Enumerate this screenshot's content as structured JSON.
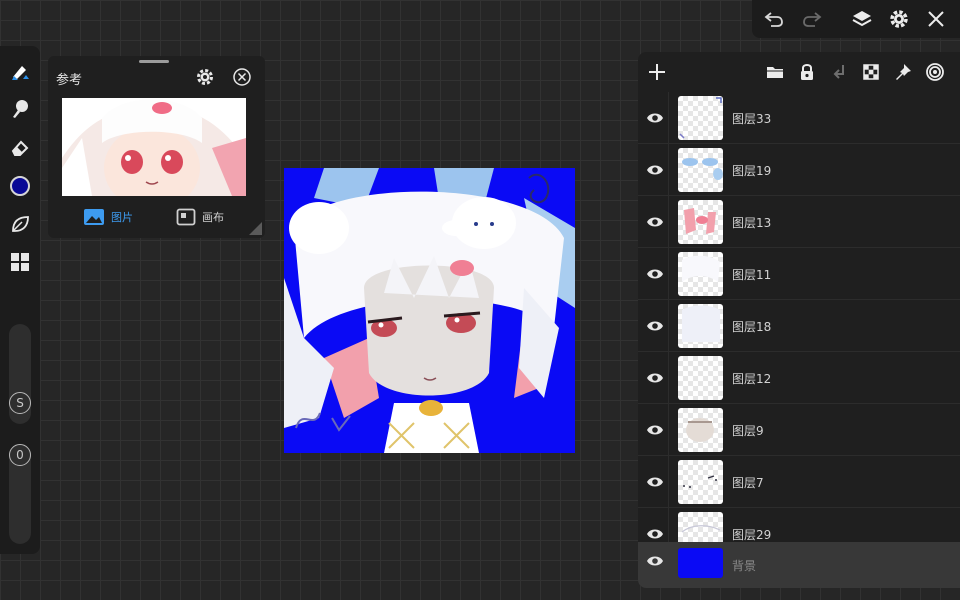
{
  "reference_panel": {
    "title": "参考",
    "tabs": [
      {
        "label": "图片",
        "active": true
      },
      {
        "label": "画布",
        "active": false
      }
    ]
  },
  "toolbar": {
    "color": "#0a0a96",
    "size_label": "S",
    "opacity_label": "0",
    "icons": [
      "brush-icon",
      "smudge-icon",
      "eraser-icon",
      "color-swatch",
      "leaf-icon",
      "grid-icon"
    ]
  },
  "top_bar": {
    "icons": [
      "undo-icon",
      "redo-icon",
      "layers-icon",
      "settings-icon",
      "close-icon"
    ]
  },
  "layers_panel": {
    "header_icons": [
      "add-layer-icon",
      "folder-icon",
      "lock-icon",
      "merge-down-icon",
      "transparency-icon",
      "pin-icon",
      "target-icon"
    ],
    "layers": [
      {
        "name": "图层33",
        "selected": false
      },
      {
        "name": "图层19",
        "selected": false
      },
      {
        "name": "图层13",
        "selected": false
      },
      {
        "name": "图层11",
        "selected": false
      },
      {
        "name": "图层18",
        "selected": false
      },
      {
        "name": "图层12",
        "selected": false
      },
      {
        "name": "图层9",
        "selected": false
      },
      {
        "name": "图层7",
        "selected": false
      },
      {
        "name": "图层29",
        "selected": false
      },
      {
        "name": "背景",
        "selected": true,
        "fill": "#0a0af5"
      }
    ]
  },
  "colors": {
    "accent": "#3d9bf0",
    "canvas_background": "#0a0af5",
    "panel": "#1f1f1f"
  }
}
